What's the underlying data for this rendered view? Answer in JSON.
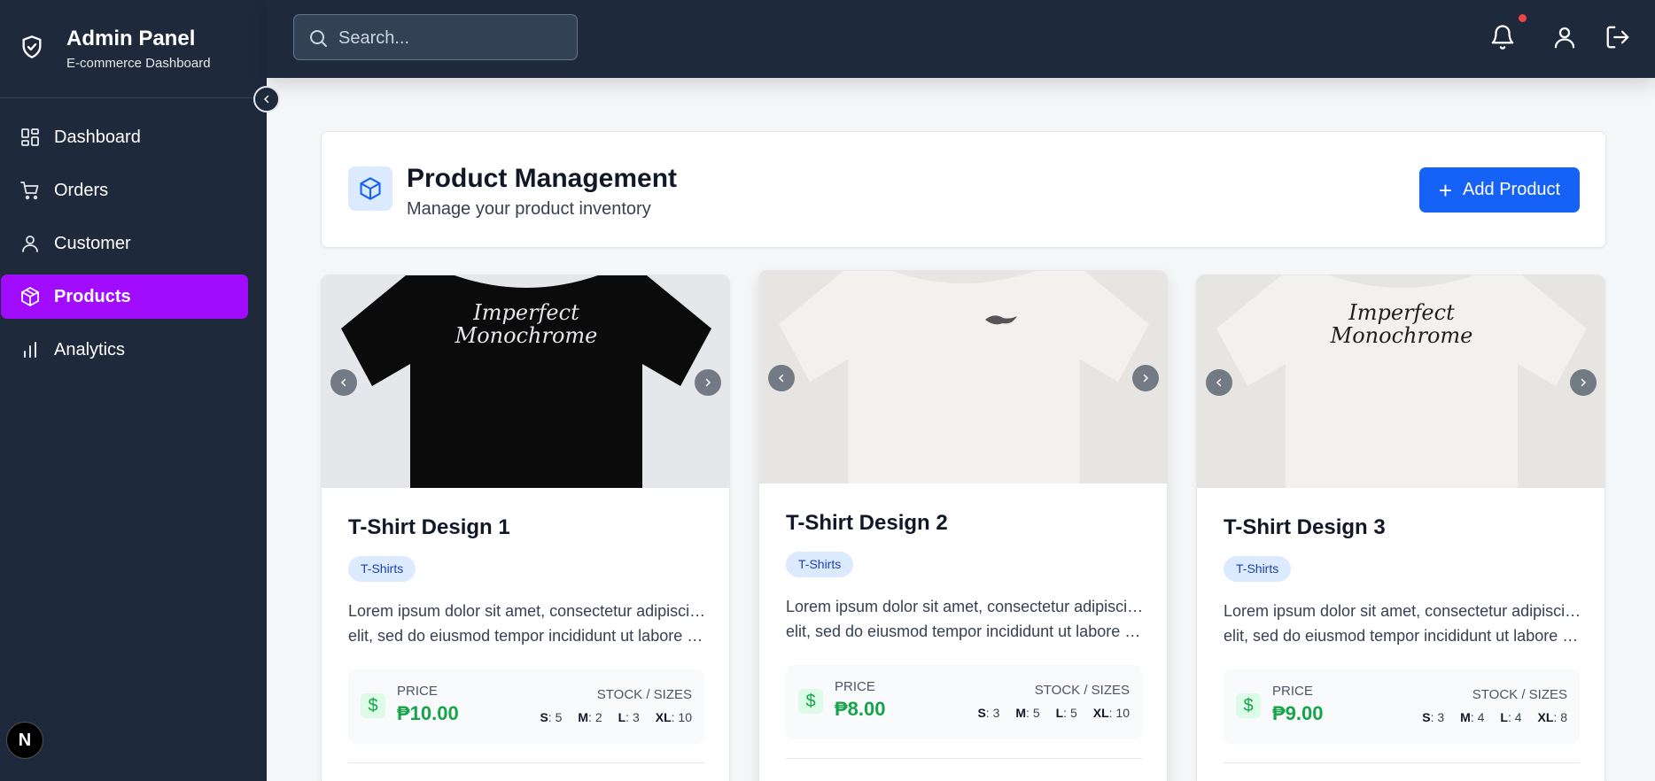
{
  "brand": {
    "title": "Admin Panel",
    "subtitle": "E-commerce Dashboard"
  },
  "sidebar": {
    "items": [
      {
        "label": "Dashboard",
        "icon": "grid-icon",
        "active": false
      },
      {
        "label": "Orders",
        "icon": "cart-icon",
        "active": false
      },
      {
        "label": "Customer",
        "icon": "user-icon",
        "active": false
      },
      {
        "label": "Products",
        "icon": "box-icon",
        "active": true
      },
      {
        "label": "Analytics",
        "icon": "bar-chart-icon",
        "active": false
      }
    ],
    "footer_badge": "N"
  },
  "topbar": {
    "search_placeholder": "Search...",
    "icons": [
      "bell-icon",
      "user-icon",
      "logout-icon"
    ]
  },
  "header": {
    "title": "Product Management",
    "subtitle": "Manage your product inventory",
    "add_button": "Add Product"
  },
  "products": [
    {
      "title": "T-Shirt Design 1",
      "category": "T-Shirts",
      "desc_line1": "Lorem ipsum dolor sit amet, consectetur adipiscing",
      "desc_line2": "elit, sed do eiusmod tempor incididunt ut labore et dolore",
      "price_label": "PRICE",
      "price": "₱10.00",
      "stock_label": "STOCK / SIZES",
      "sizes": {
        "S": "5",
        "M": "2",
        "L": "3",
        "XL": "10"
      },
      "shirt_color": "#0b0b0b",
      "print_text": "Imperfect Monochrome"
    },
    {
      "title": "T-Shirt Design 2",
      "category": "T-Shirts",
      "desc_line1": "Lorem ipsum dolor sit amet, consectetur adipiscing",
      "desc_line2": "elit, sed do eiusmod tempor incididunt ut labore et dolore",
      "price_label": "PRICE",
      "price": "₱8.00",
      "stock_label": "STOCK / SIZES",
      "sizes": {
        "S": "3",
        "M": "5",
        "L": "5",
        "XL": "10"
      },
      "shirt_color": "#f3f1ed",
      "print_text": ""
    },
    {
      "title": "T-Shirt Design 3",
      "category": "T-Shirts",
      "desc_line1": "Lorem ipsum dolor sit amet, consectetur adipiscing",
      "desc_line2": "elit, sed do eiusmod tempor incididunt ut labore et dolore",
      "price_label": "PRICE",
      "price": "₱9.00",
      "stock_label": "STOCK / SIZES",
      "sizes": {
        "S": "3",
        "M": "4",
        "L": "4",
        "XL": "8"
      },
      "shirt_color": "#f3f1ed",
      "print_text": "Imperfect Monochrome"
    }
  ],
  "colors": {
    "sidebar_bg": "#1e293b",
    "active_item": "#a10cff",
    "primary_button": "#1662f7",
    "price_green": "#16a34a",
    "tag_bg": "#dbeafe"
  }
}
